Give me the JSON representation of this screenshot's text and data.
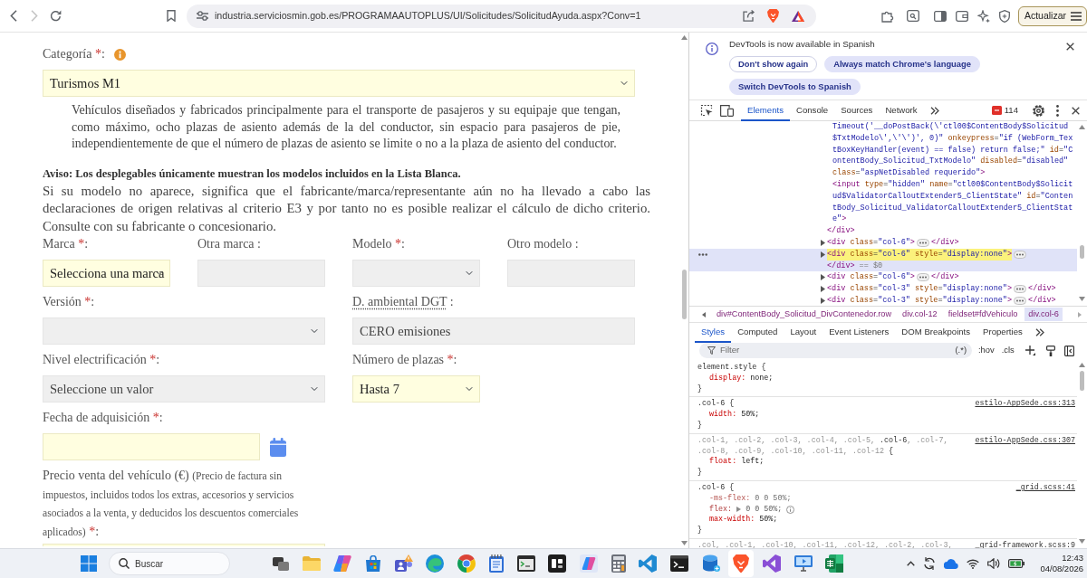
{
  "browser": {
    "forward_disabled": true,
    "url": "industria.serviciosmin.gob.es/PROGRAMAAUTOPLUS/UI/Solicitudes/SolicitudAyuda.aspx?Conv=1",
    "update_button": "Actualizar"
  },
  "form": {
    "category": {
      "label": "Categoría",
      "required_mark": "*",
      "suffix": ":",
      "value": "Turismos M1",
      "disabled": false
    },
    "category_description": "Vehículos diseñados y fabricados principalmente para el transporte de pasajeros y su equipaje que tengan, como máximo, ocho plazas de asiento además de la del conductor, sin espacio para pasajeros de pie, independientemente de que el número de plazas de asiento se limite o no a la plaza de asiento del conductor.",
    "notice_title": "Aviso: Los desplegables únicamente muestran los modelos incluidos en la Lista Blanca.",
    "notice_text": "Si su modelo no aparece, significa que el fabricante/marca/representante aún no ha llevado a cabo las declaraciones de origen relativas al criterio E3 y por tanto no es posible realizar el cálculo de dicho criterio. Consulte con su fabricante o concesionario.",
    "rows": [
      {
        "fields": [
          {
            "kind": "select",
            "label": "Marca",
            "required_mark": "*",
            "suffix": ":",
            "value": "Selecciona una marca",
            "disabled": false
          },
          {
            "kind": "input",
            "label": "Otra marca",
            "suffix": " :",
            "disabled": true
          },
          {
            "kind": "select",
            "label": "Modelo",
            "required_mark": "*",
            "suffix": ":",
            "disabled": true
          },
          {
            "kind": "input",
            "label": "Otro modelo",
            "suffix": " :",
            "disabled": true
          }
        ]
      },
      {
        "fields": [
          {
            "kind": "select",
            "label": "Versión",
            "required_mark": "*",
            "suffix": ":",
            "disabled": true
          },
          {
            "kind": "input",
            "label": "D. ambiental DGT",
            "abbreviation": true,
            "suffix": " :",
            "value": "CERO emisiones",
            "disabled": true
          }
        ]
      },
      {
        "fields": [
          {
            "kind": "select",
            "label": "Nivel electrificación",
            "required_mark": "*",
            "suffix": ":",
            "value": "Seleccione un valor",
            "disabled": true
          },
          {
            "kind": "select",
            "label": "Número de plazas",
            "required_mark": "*",
            "suffix": ":",
            "value": "Hasta 7",
            "disabled": false
          }
        ]
      },
      {
        "fields": [
          {
            "kind": "date",
            "label": "Fecha de adquisición",
            "required_mark": "*",
            "suffix": ":",
            "disabled": false
          }
        ]
      },
      {
        "fields": [
          {
            "kind": "input",
            "label": "Precio venta del vehículo (€)",
            "note": "(Precio de factura sin impuestos, incluidos todos los extras, accesorios y servicios asociados a la venta, y deducidos los descuentos comerciales aplicados)",
            "required_mark": "*",
            "suffix": ":",
            "disabled": false
          }
        ]
      }
    ]
  },
  "devtools": {
    "infobar": {
      "message": "DevTools is now available in Spanish",
      "buttons": [
        {
          "label": "Don't show again",
          "kind": "outline"
        },
        {
          "label": "Always match Chrome's language",
          "kind": "tonal"
        },
        {
          "label": "Switch DevTools to Spanish",
          "kind": "tonal"
        }
      ]
    },
    "tabs": [
      {
        "label": "Elements",
        "selected": true
      },
      {
        "label": "Console",
        "selected": false
      },
      {
        "label": "Sources",
        "selected": false
      },
      {
        "label": "Network",
        "selected": false
      }
    ],
    "error_count": "114",
    "dom_tree": [
      {
        "children": [
          {
            "lines": [
              [
                {
                  "kind": "value",
                  "text": "Timeout('__doPostBack(\\'ctl00$ContentBody$Solicitud"
                }
              ],
              [
                {
                  "kind": "value",
                  "text": "$TxtModelo\\',\\'\\')', 0)\""
                },
                {
                  "kind": "attr",
                  "text": " onkeypress"
                },
                {
                  "kind": "punct",
                  "text": "="
                },
                {
                  "kind": "value",
                  "text": "\"if (WebForm_Tex"
                }
              ],
              [
                {
                  "kind": "value",
                  "text": "tBoxKeyHandler(event) == false) return false;\""
                },
                {
                  "kind": "attr",
                  "text": " id"
                },
                {
                  "kind": "punct",
                  "text": "="
                },
                {
                  "kind": "value",
                  "text": "\"C"
                }
              ],
              [
                {
                  "kind": "value",
                  "text": "ontentBody_Solicitud_TxtModelo\""
                },
                {
                  "kind": "attr",
                  "text": " disabled"
                },
                {
                  "kind": "punct",
                  "text": "="
                },
                {
                  "kind": "value",
                  "text": "\"disabled\""
                }
              ],
              [
                {
                  "kind": "attr",
                  "text": "class"
                },
                {
                  "kind": "punct",
                  "text": "="
                },
                {
                  "kind": "value",
                  "text": "\"aspNetDisabled requerido\""
                },
                {
                  "kind": "tag",
                  "text": ">"
                }
              ]
            ]
          },
          {
            "lines": [
              [
                {
                  "kind": "tag",
                  "text": "<input"
                },
                {
                  "kind": "attr",
                  "text": " type"
                },
                {
                  "kind": "punct",
                  "text": "="
                },
                {
                  "kind": "value",
                  "text": "\"hidden\""
                },
                {
                  "kind": "attr",
                  "text": " name"
                },
                {
                  "kind": "punct",
                  "text": "="
                },
                {
                  "kind": "value",
                  "text": "\"ctl00$ContentBody$Solicit"
                }
              ],
              [
                {
                  "kind": "value",
                  "text": "ud$ValidatorCalloutExtender5_ClientState\""
                },
                {
                  "kind": "attr",
                  "text": " id"
                },
                {
                  "kind": "punct",
                  "text": "="
                },
                {
                  "kind": "value",
                  "text": "\"Conten"
                }
              ],
              [
                {
                  "kind": "value",
                  "text": "tBody_Solicitud_ValidatorCalloutExtender5_ClientStat"
                }
              ],
              [
                {
                  "kind": "value",
                  "text": "e\""
                },
                {
                  "kind": "tag",
                  "text": ">"
                }
              ]
            ]
          }
        ],
        "close": [
          {
            "kind": "tag",
            "text": "</div>"
          }
        ]
      },
      {
        "expandable": true,
        "collapsed": true,
        "selected": false,
        "highlighted": false,
        "open": [
          {
            "kind": "tag",
            "text": "<div"
          },
          {
            "kind": "attr",
            "text": " class"
          },
          {
            "kind": "punct",
            "text": "="
          },
          {
            "kind": "value",
            "text": "\"col-6\""
          },
          {
            "kind": "tag",
            "text": ">"
          }
        ],
        "close": [
          {
            "kind": "tag",
            "text": "</div>"
          }
        ]
      },
      {
        "expandable": true,
        "collapsed": true,
        "selected": true,
        "highlighted": true,
        "open": [
          {
            "kind": "tag",
            "text": "<div"
          },
          {
            "kind": "attr",
            "text": " class"
          },
          {
            "kind": "punct",
            "text": "="
          },
          {
            "kind": "value",
            "text": "\"col-6\""
          },
          {
            "kind": "attr",
            "text": " style"
          },
          {
            "kind": "punct",
            "text": "="
          },
          {
            "kind": "value",
            "text": "\"display:none\""
          },
          {
            "kind": "tag",
            "text": ">"
          }
        ],
        "close": [
          {
            "kind": "tag",
            "text": "</div>"
          }
        ],
        "reference": "== $0"
      },
      {
        "expandable": true,
        "collapsed": true,
        "selected": false,
        "highlighted": false,
        "open": [
          {
            "kind": "tag",
            "text": "<div"
          },
          {
            "kind": "attr",
            "text": " class"
          },
          {
            "kind": "punct",
            "text": "="
          },
          {
            "kind": "value",
            "text": "\"col-6\""
          },
          {
            "kind": "tag",
            "text": ">"
          }
        ],
        "close": [
          {
            "kind": "tag",
            "text": "</div>"
          }
        ]
      },
      {
        "expandable": true,
        "collapsed": true,
        "selected": false,
        "highlighted": false,
        "open": [
          {
            "kind": "tag",
            "text": "<div"
          },
          {
            "kind": "attr",
            "text": " class"
          },
          {
            "kind": "punct",
            "text": "="
          },
          {
            "kind": "value",
            "text": "\"col-3\""
          },
          {
            "kind": "attr",
            "text": " style"
          },
          {
            "kind": "punct",
            "text": "="
          },
          {
            "kind": "value",
            "text": "\"display:none\""
          },
          {
            "kind": "tag",
            "text": ">"
          }
        ],
        "close": [
          {
            "kind": "tag",
            "text": "</div>"
          }
        ]
      },
      {
        "expandable": true,
        "collapsed": true,
        "selected": false,
        "highlighted": false,
        "open": [
          {
            "kind": "tag",
            "text": "<div"
          },
          {
            "kind": "attr",
            "text": " class"
          },
          {
            "kind": "punct",
            "text": "="
          },
          {
            "kind": "value",
            "text": "\"col-3\""
          },
          {
            "kind": "attr",
            "text": " style"
          },
          {
            "kind": "punct",
            "text": "="
          },
          {
            "kind": "value",
            "text": "\"display:none\""
          },
          {
            "kind": "tag",
            "text": ">"
          }
        ],
        "close": [
          {
            "kind": "tag",
            "text": "</div>"
          }
        ]
      }
    ],
    "breadcrumbs": [
      {
        "label": "div#ContentBody_Solicitud_DivContenedor.row",
        "selected": false
      },
      {
        "label": "div.col-12",
        "selected": false
      },
      {
        "label": "fieldset#fdVehiculo",
        "selected": false
      },
      {
        "label": "div.col-6",
        "selected": true
      }
    ],
    "sidebar_tabs": [
      {
        "label": "Styles",
        "selected": true
      },
      {
        "label": "Computed",
        "selected": false
      },
      {
        "label": "Layout",
        "selected": false
      },
      {
        "label": "Event Listeners",
        "selected": false
      },
      {
        "label": "DOM Breakpoints",
        "selected": false
      },
      {
        "label": "Properties",
        "selected": false
      }
    ],
    "filter": {
      "placeholder": "Filter",
      "regex_toggle": "(.*)"
    },
    "style_tools": [
      ":hov",
      ".cls"
    ],
    "rules": [
      {
        "selector": [
          {
            "text": "element.style",
            "matched": true
          }
        ],
        "open": "{",
        "declarations": [
          {
            "property": "display:",
            "value": "none;",
            "overridden": false,
            "inactive": false
          }
        ],
        "close": "}"
      },
      {
        "selector": [
          {
            "text": ".col-6",
            "matched": true
          }
        ],
        "open": "{",
        "source": "estilo-AppSede.css:313",
        "declarations": [
          {
            "property": "width:",
            "value": "50%;",
            "overridden": false,
            "inactive": false
          }
        ],
        "close": "}"
      },
      {
        "selector": [
          {
            "text": ".col-1, .col-2, .col-3, .col-4, .col-5,",
            "matched": false
          },
          {
            "text": ".col-6",
            "matched": true
          },
          {
            "text": ", .col-7, .col-8, .col-9, .col-10, .col-11, .col-12",
            "matched": false
          }
        ],
        "open": "{",
        "source": "estilo-AppSede.css:307",
        "declarations": [
          {
            "property": "float:",
            "value": "left;",
            "overridden": false,
            "inactive": false
          }
        ],
        "close": "}"
      },
      {
        "selector": [
          {
            "text": ".col-6",
            "matched": true
          }
        ],
        "open": "{",
        "source": "_grid.scss:41",
        "declarations": [
          {
            "property": "-ms-flex:",
            "value": "0 0 50%;",
            "overridden": true,
            "inactive": false
          },
          {
            "property": "flex:",
            "value": "0 0 50%;",
            "overridden": false,
            "inactive": true,
            "expandable": true,
            "hint": true
          },
          {
            "property": "max-width:",
            "value": "50%;",
            "overridden": false,
            "inactive": false
          }
        ],
        "close": "}"
      },
      {
        "selector": [
          {
            "text": ".col, .col-1, .col-10, .col-11, .col-12, .col-2, .col-3,",
            "matched": false
          }
        ],
        "source": "_grid-framework.scss:9"
      }
    ]
  },
  "taskbar": {
    "search": {
      "placeholder": "Buscar"
    },
    "apps": [
      {
        "highlighted": false
      },
      {
        "highlighted": false
      },
      {
        "highlighted": false
      },
      {
        "highlighted": false
      },
      {
        "highlighted": false
      },
      {
        "highlighted": false
      },
      {
        "highlighted": false
      },
      {
        "highlighted": false
      },
      {
        "highlighted": false
      },
      {
        "highlighted": false
      },
      {
        "highlighted": false
      },
      {
        "highlighted": false
      },
      {
        "highlighted": false
      },
      {
        "highlighted": false
      },
      {
        "highlighted": false
      },
      {
        "highlighted": true
      },
      {
        "highlighted": false
      },
      {
        "highlighted": false
      },
      {
        "highlighted": false
      }
    ],
    "time": "12:43",
    "date": "04/08/2026"
  }
}
